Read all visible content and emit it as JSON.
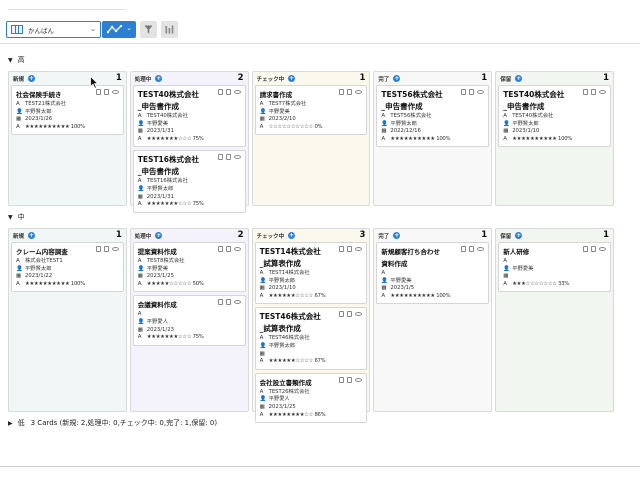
{
  "toolbar": {
    "view_label": "かんばん",
    "colors": {
      "accent": "#2d7fd3"
    }
  },
  "groups": [
    {
      "label": "高",
      "columns": [
        {
          "name": "新規",
          "count": "1",
          "cards": [
            {
              "title": "社会保険手続き",
              "company": "TEST21株式会社",
              "person": "平野賢太郎",
              "date": "2023/1/26",
              "progress": "★★★★★★★★★★ 100%"
            }
          ]
        },
        {
          "name": "処理中",
          "count": "2",
          "cards": [
            {
              "title": "TEST40株式会社_申告書作成",
              "company": "TEST40株式会社",
              "person": "平野愛美",
              "date": "2023/1/31",
              "progress": "★★★★★★★☆☆☆ 75%"
            },
            {
              "title": "TEST16株式会社_申告書作成",
              "company": "TEST16株式会社",
              "person": "平野賢太郎",
              "date": "2023/1/31",
              "progress": "★★★★★★★☆☆☆ 75%"
            }
          ]
        },
        {
          "name": "チェック中",
          "count": "1",
          "cards": [
            {
              "title": "請求書作成",
              "company": "TEST7株式会社",
              "person": "平野愛美",
              "date": "2023/2/10",
              "progress": "☆☆☆☆☆☆☆☆☆☆ 0%"
            }
          ]
        },
        {
          "name": "完了",
          "count": "1",
          "cards": [
            {
              "title": "TEST56株式会社_申告書作成",
              "company": "TEST56株式会社",
              "person": "平野賢太郎",
              "date": "2022/12/16",
              "progress": "★★★★★★★★★★ 100%"
            }
          ]
        },
        {
          "name": "保留",
          "count": "1",
          "cards": [
            {
              "title": "TEST40株式会社_申告書作成",
              "company": "TEST40株式会社",
              "person": "平野賢太郎",
              "date": "2023/1/10",
              "progress": "★★★★★★★★★★ 100%"
            }
          ]
        }
      ]
    },
    {
      "label": "中",
      "columns": [
        {
          "name": "新規",
          "count": "1",
          "cards": [
            {
              "title": "クレーム内容調査",
              "company": "株式会社TEST1",
              "person": "平野賢太郎",
              "date": "2023/1/22",
              "progress": "★★★★★★★★★★ 100%"
            }
          ]
        },
        {
          "name": "処理中",
          "count": "2",
          "cards": [
            {
              "title": "提案資料作成",
              "company": "TEST8株式会社",
              "person": "平野愛美",
              "date": "2023/1/25",
              "progress": "★★★★★☆☆☆☆☆ 50%"
            },
            {
              "title": "会議資料作成",
              "company": "",
              "person": "平野愛人",
              "date": "2023/1/23",
              "progress": "★★★★★★★☆☆☆ 75%"
            }
          ]
        },
        {
          "name": "チェック中",
          "count": "3",
          "cards": [
            {
              "title": "TEST14株式会社_試算表作成",
              "company": "TEST14株式会社",
              "person": "平野賢太郎",
              "date": "2023/1/10",
              "progress": "★★★★★★☆☆☆☆ 67%"
            },
            {
              "title": "TEST46株式会社_試算表作成",
              "company": "TEST46株式会社",
              "person": "平野賢太郎",
              "date": "",
              "progress": "★★★★★★☆☆☆☆ 67%"
            },
            {
              "title": "会社設立書類作成",
              "company": "TEST26株式会社",
              "person": "平野愛人",
              "date": "2023/1/25",
              "progress": "★★★★★★★★☆☆ 86%"
            }
          ]
        },
        {
          "name": "完了",
          "count": "1",
          "cards": [
            {
              "title": "新規顧客打ち合わせ資料作成",
              "company": "",
              "person": "平野愛美",
              "date": "2023/1/5",
              "progress": "★★★★★★★★★★ 100%"
            }
          ]
        },
        {
          "name": "保留",
          "count": "1",
          "cards": [
            {
              "title": "新人研修",
              "company": "",
              "person": "平野愛美",
              "date": "",
              "progress": "★★★☆☆☆☆☆☆☆ 33%"
            }
          ]
        }
      ]
    }
  ],
  "bottom_group": {
    "label": "低",
    "summary": "3 Cards (新規: 2,処理中: 0,チェック中: 0,完了: 1,保留: 0)"
  }
}
